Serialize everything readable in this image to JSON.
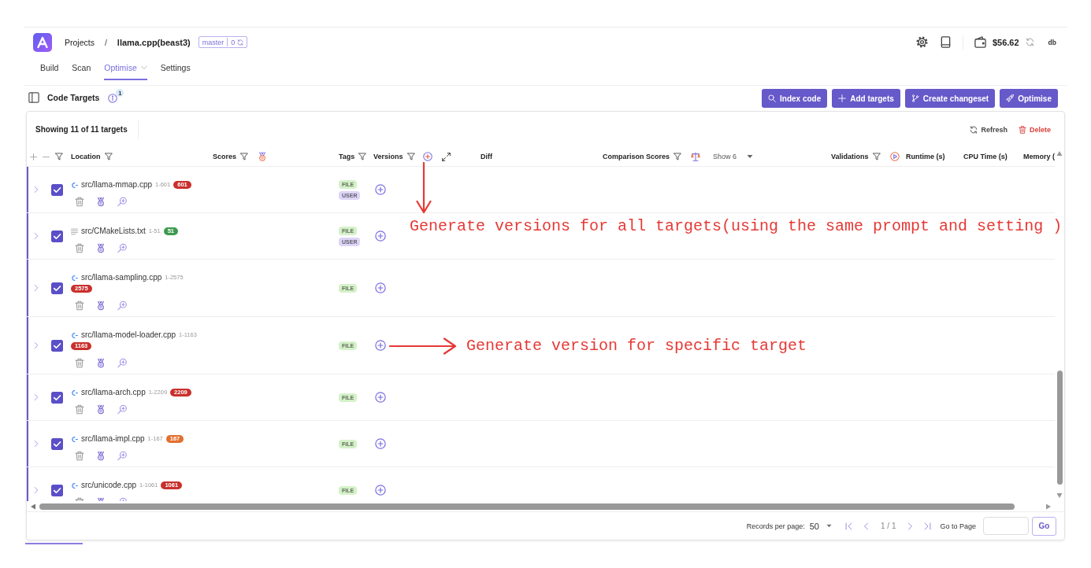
{
  "header": {
    "breadcrumb": [
      {
        "label": "Projects",
        "current": false
      },
      {
        "label": "llama.cpp(beast3)",
        "current": true
      }
    ],
    "breadcrumb_separator": "/",
    "branch": {
      "name": "master",
      "changes": "0"
    },
    "balance": "$56.62",
    "user": "db"
  },
  "nav_tabs": [
    {
      "label": "Build",
      "selected": false,
      "dropdown": false
    },
    {
      "label": "Scan",
      "selected": false,
      "dropdown": false
    },
    {
      "label": "Optimise",
      "selected": true,
      "dropdown": true
    },
    {
      "label": "Settings",
      "selected": false,
      "dropdown": false
    }
  ],
  "toolbar": {
    "title": "Code Targets",
    "info_count": "1",
    "buttons": [
      {
        "label": "Index code",
        "kind": "index"
      },
      {
        "label": "Add targets",
        "kind": "add"
      },
      {
        "label": "Create changeset",
        "kind": "changeset"
      },
      {
        "label": "Optimise",
        "kind": "optimise"
      }
    ]
  },
  "table": {
    "summary": "Showing 11 of 11 targets",
    "actions": [
      {
        "label": "Refresh",
        "kind": "refresh"
      },
      {
        "label": "Delete",
        "kind": "delete"
      }
    ],
    "columns": [
      {
        "label": "Location",
        "kind": "location",
        "filterable": true
      },
      {
        "label": "Scores",
        "kind": "scores",
        "filterable": true
      },
      {
        "label": "Tags",
        "kind": "tags",
        "filterable": true
      },
      {
        "label": "Versions",
        "kind": "versions",
        "filterable": true
      },
      {
        "label": "Diff",
        "kind": "diff",
        "filterable": false
      },
      {
        "label": "Comparison Scores",
        "kind": "comparison",
        "filterable": true,
        "show": "Show 6"
      },
      {
        "label": "Validations",
        "kind": "validations",
        "filterable": true
      },
      {
        "label": "Runtime (s)",
        "kind": "runtime",
        "filterable": false
      },
      {
        "label": "CPU Time (s)",
        "kind": "cpu",
        "filterable": false
      },
      {
        "label": "Memory (",
        "kind": "memory",
        "filterable": false
      }
    ],
    "rows": [
      {
        "kind": "cpp",
        "path": "src/llama-mmap.cpp",
        "range": "1-601",
        "score": "601",
        "color": "#c9302c",
        "checked": true,
        "tags": [
          {
            "label": "FILE",
            "color": "#d5f1c9"
          },
          {
            "label": "USER",
            "color": "#ddd5f5"
          }
        ]
      },
      {
        "kind": "text",
        "path": "src/CMakeLists.txt",
        "range": "1-51",
        "score": "51",
        "color": "#3d9a4f",
        "checked": true,
        "tags": [
          {
            "label": "FILE",
            "color": "#d5f1c9"
          },
          {
            "label": "USER",
            "color": "#ddd5f5"
          }
        ]
      },
      {
        "kind": "cpp",
        "path": "src/llama-sampling.cpp",
        "range": "1-2575",
        "score": "2575",
        "color": "#c9302c",
        "checked": true,
        "tags": [
          {
            "label": "FILE",
            "color": "#d5f1c9"
          }
        ]
      },
      {
        "kind": "cpp",
        "path": "src/llama-model-loader.cpp",
        "range": "1-1163",
        "score": "1163",
        "color": "#c9302c",
        "checked": true,
        "tags": [
          {
            "label": "FILE",
            "color": "#d5f1c9"
          }
        ]
      },
      {
        "kind": "cpp",
        "path": "src/llama-arch.cpp",
        "range": "1-2209",
        "score": "2209",
        "color": "#c9302c",
        "checked": true,
        "tags": [
          {
            "label": "FILE",
            "color": "#d5f1c9"
          }
        ]
      },
      {
        "kind": "cpp",
        "path": "src/llama-impl.cpp",
        "range": "1-167",
        "score": "167",
        "color": "#e2702f",
        "checked": true,
        "tags": [
          {
            "label": "FILE",
            "color": "#d5f1c9"
          }
        ]
      },
      {
        "kind": "cpp",
        "path": "src/unicode.cpp",
        "range": "1-1061",
        "score": "1061",
        "color": "#c9302c",
        "checked": true,
        "tags": [
          {
            "label": "FILE",
            "color": "#d5f1c9"
          }
        ]
      }
    ]
  },
  "pagination": {
    "records_label": "Records per page:",
    "page_size": "50",
    "page": "1 / 1",
    "goto_label": "Go to Page",
    "go_button": "Go"
  },
  "annotations": [
    {
      "kind": "down",
      "text": "Generate versions for all targets(using the same prompt and setting )"
    },
    {
      "kind": "right",
      "text": "Generate version for specific target"
    }
  ]
}
